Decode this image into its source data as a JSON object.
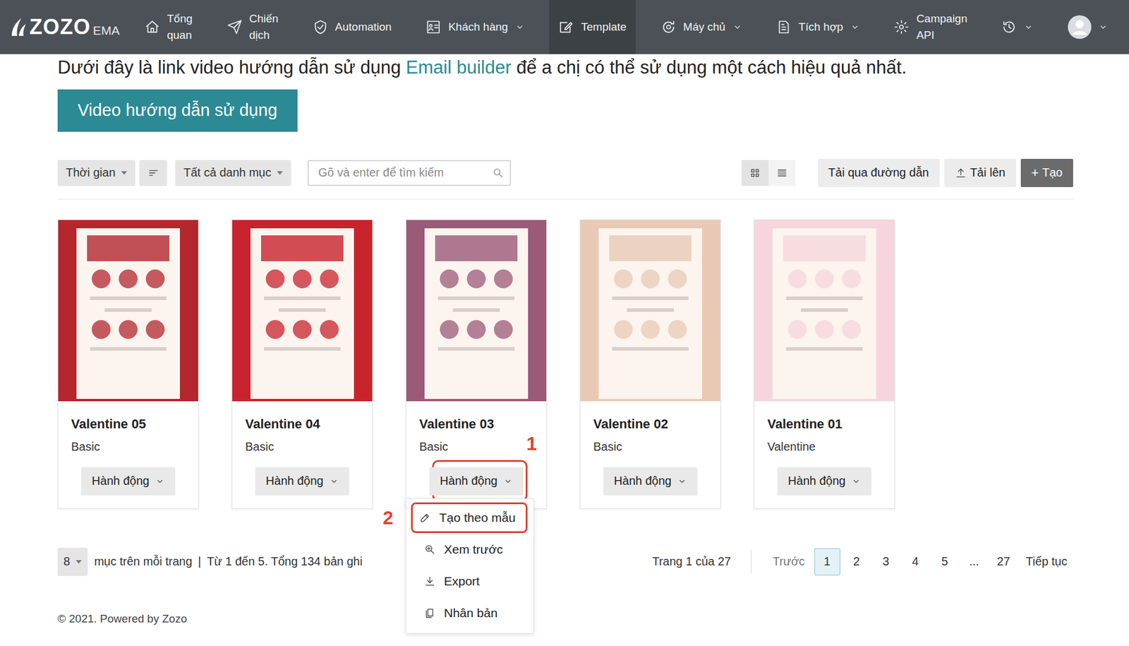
{
  "nav": {
    "logo": "ZOZO",
    "logo_suffix": "EMA",
    "items": [
      {
        "label": "Tổng quan",
        "selected": false,
        "dropdown": false
      },
      {
        "label": "Chiến dịch",
        "selected": false,
        "dropdown": false
      },
      {
        "label": "Automation",
        "selected": false,
        "dropdown": false
      },
      {
        "label": "Khách hàng",
        "selected": false,
        "dropdown": true
      },
      {
        "label": "Template",
        "selected": true,
        "dropdown": false
      },
      {
        "label": "Máy chủ",
        "selected": false,
        "dropdown": true
      },
      {
        "label": "Tích hợp",
        "selected": false,
        "dropdown": true
      },
      {
        "label": "Campaign API",
        "selected": false,
        "dropdown": false
      }
    ]
  },
  "intro": {
    "text_before": "Dưới đây là link video hướng dẫn sử dụng ",
    "link": "Email builder",
    "text_after": " để a chị có thể sử dụng một cách hiệu quả nhất."
  },
  "video_button": "Video hướng dẫn sử dụng",
  "toolbar": {
    "time_filter": "Thời gian",
    "category_filter": "Tất cả danh mục",
    "search": {
      "placeholder": "Gõ và enter để tìm kiếm"
    },
    "view_modes": [
      {
        "kind": "grid",
        "selected": true
      },
      {
        "kind": "list",
        "selected": false
      }
    ],
    "link_upload": "Tải qua đường dẫn",
    "upload": "Tải lên",
    "create_icon": "+",
    "create": "Tạo"
  },
  "templates": [
    {
      "name": "Valentine 05",
      "category": "Basic",
      "action": "Hành động",
      "color": "#b3272d",
      "highlighted": false,
      "menu_open": false
    },
    {
      "name": "Valentine 04",
      "category": "Basic",
      "action": "Hành động",
      "color": "#c8232c",
      "highlighted": false,
      "menu_open": false
    },
    {
      "name": "Valentine 03",
      "category": "Basic",
      "action": "Hành động",
      "color": "#9b5a78",
      "highlighted": true,
      "menu_open": true
    },
    {
      "name": "Valentine 02",
      "category": "Basic",
      "action": "Hành động",
      "color": "#e9c9b4",
      "highlighted": false,
      "menu_open": false
    },
    {
      "name": "Valentine 01",
      "category": "Valentine",
      "action": "Hành động",
      "color": "#f6d6dc",
      "highlighted": false,
      "menu_open": false
    }
  ],
  "action_menu": [
    {
      "label": "Tạo theo mẫu",
      "highlighted": true
    },
    {
      "label": "Xem trước",
      "highlighted": false
    },
    {
      "label": "Export",
      "highlighted": false
    },
    {
      "label": "Nhân bản",
      "highlighted": false
    }
  ],
  "annotations": {
    "step1": "1",
    "step2": "2"
  },
  "pagination": {
    "per_page": "8",
    "per_page_label": "mục trên mỗi trang",
    "separator": "|",
    "summary": "Từ 1 đến 5. Tổng 134 bản ghi",
    "page_info": "Trang 1 của 27",
    "prev": "Trước",
    "pages": [
      {
        "label": "1",
        "selected": true
      },
      {
        "label": "2",
        "selected": false
      },
      {
        "label": "3",
        "selected": false
      },
      {
        "label": "4",
        "selected": false
      },
      {
        "label": "5",
        "selected": false
      },
      {
        "label": "...",
        "selected": false
      },
      {
        "label": "27",
        "selected": false
      }
    ],
    "next": "Tiếp tục"
  },
  "footer": "© 2021. Powered by Zozo"
}
